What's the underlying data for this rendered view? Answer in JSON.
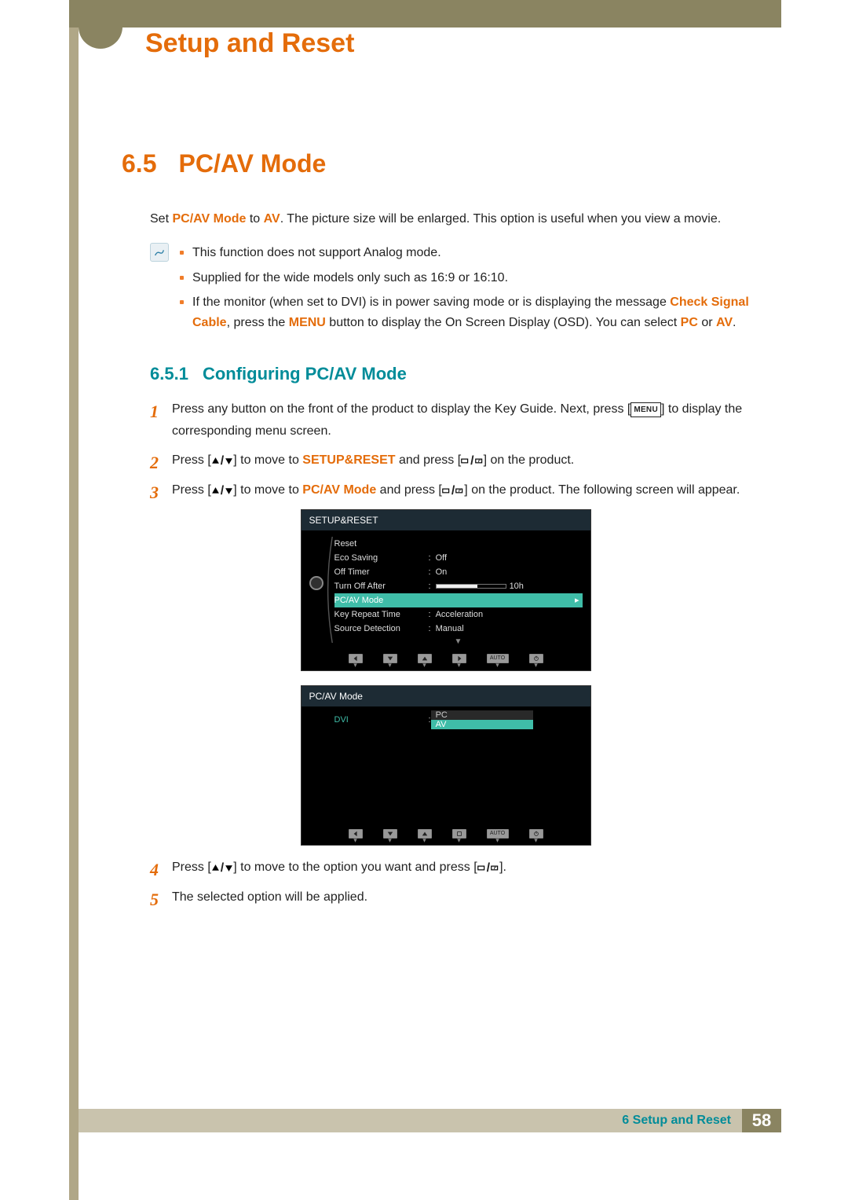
{
  "chapter_title": "Setup and Reset",
  "section": {
    "number": "6.5",
    "title": "PC/AV Mode",
    "intro_pre": "Set ",
    "intro_b1": "PC/AV Mode",
    "intro_mid": " to ",
    "intro_b2": "AV",
    "intro_post": ". The picture size will be enlarged. This option is useful when you view a movie."
  },
  "notes": [
    "This function does not support Analog mode.",
    "Supplied for the wide models only such as 16:9 or 16:10.",
    "(note 3 is composed)"
  ],
  "note3": {
    "p1": "If the monitor (when set to DVI) is in power saving mode or is displaying the message ",
    "b1": "Check Signal Cable",
    "p2": ", press the ",
    "b2": "MENU",
    "p3": " button to display the On Screen Display (OSD). You can select ",
    "b3": "PC",
    "p4": " or ",
    "b4": "AV",
    "p5": "."
  },
  "subsection": {
    "number": "6.5.1",
    "title": "Configuring PC/AV Mode"
  },
  "steps": {
    "s1a": "Press any button on the front of the product to display the Key Guide. Next, press [",
    "s1_menu": "MENU",
    "s1b": "] to display the corresponding menu screen.",
    "s2a": "Press [",
    "s2b": "] to move to ",
    "s2_tgt": "SETUP&RESET",
    "s2c": " and press [",
    "s2d": "] on the product.",
    "s3a": "Press [",
    "s3b": "] to move to ",
    "s3_tgt": "PC/AV Mode",
    "s3c": " and press [",
    "s3d": "] on the product. The following screen will appear.",
    "s4a": "Press [",
    "s4b": "] to move to the option you want and press [",
    "s4c": "].",
    "s5": "The selected option will be applied."
  },
  "osd1": {
    "title": "SETUP&RESET",
    "rows": [
      {
        "label": "Reset",
        "value": ""
      },
      {
        "label": "Eco Saving",
        "value": "Off"
      },
      {
        "label": "Off Timer",
        "value": "On"
      },
      {
        "label": "Turn Off After",
        "value": "10h",
        "slider": true
      },
      {
        "label": "PC/AV Mode",
        "value": "",
        "selected": true
      },
      {
        "label": "Key Repeat Time",
        "value": "Acceleration"
      },
      {
        "label": "Source Detection",
        "value": "Manual"
      }
    ],
    "bottom": [
      "back",
      "down",
      "up",
      "right",
      "AUTO",
      "power"
    ]
  },
  "osd2": {
    "title": "PC/AV Mode",
    "input": "DVI",
    "options": [
      "PC",
      "AV"
    ],
    "selected": 1,
    "bottom": [
      "back",
      "down",
      "up",
      "enter",
      "AUTO",
      "power"
    ]
  },
  "footer": {
    "label": "6 Setup and Reset",
    "page": "58"
  }
}
